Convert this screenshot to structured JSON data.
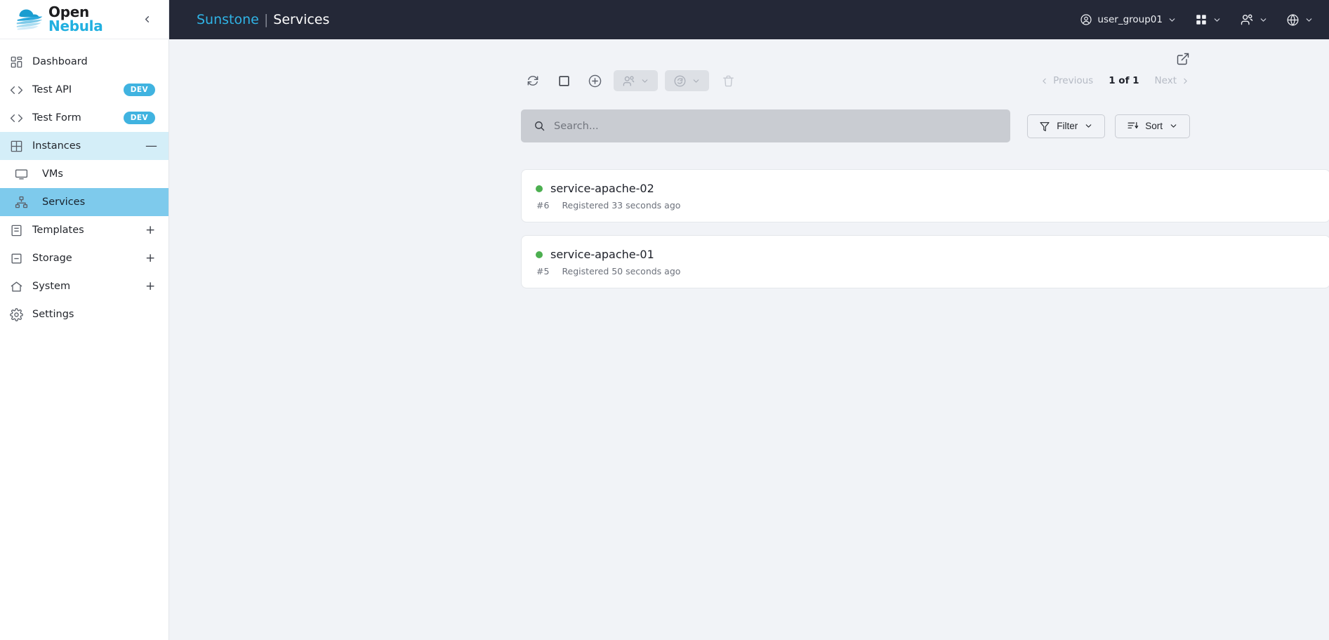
{
  "sidebar": {
    "logo": {
      "line1": "Open",
      "line2": "Nebula"
    },
    "collapse_label": "Collapse sidebar",
    "items": [
      {
        "label": "Dashboard",
        "icon": "dashboard-icon",
        "badge": "",
        "expander": ""
      },
      {
        "label": "Test API",
        "icon": "code-icon",
        "badge": "DEV",
        "expander": ""
      },
      {
        "label": "Test Form",
        "icon": "code-icon",
        "badge": "DEV",
        "expander": ""
      },
      {
        "label": "Instances",
        "icon": "grid-icon",
        "badge": "",
        "expander": "—"
      },
      {
        "label": "VMs",
        "icon": "monitor-icon",
        "badge": "",
        "expander": ""
      },
      {
        "label": "Services",
        "icon": "sitemap-icon",
        "badge": "",
        "expander": ""
      },
      {
        "label": "Templates",
        "icon": "templates-icon",
        "badge": "",
        "expander": "+"
      },
      {
        "label": "Storage",
        "icon": "storage-icon",
        "badge": "",
        "expander": "+"
      },
      {
        "label": "System",
        "icon": "home-icon",
        "badge": "",
        "expander": "+"
      },
      {
        "label": "Settings",
        "icon": "gear-icon",
        "badge": "",
        "expander": ""
      }
    ]
  },
  "header": {
    "brand": "Sunstone",
    "separator": "|",
    "section": "Services",
    "user_group": "user_group01"
  },
  "toolbar": {
    "refresh_label": "Refresh",
    "select_all_label": "Select all",
    "create_label": "Create",
    "ownership_label": "Change ownership",
    "state_label": "Change state",
    "delete_label": "Delete"
  },
  "pagination": {
    "previous": "Previous",
    "count": "1 of 1",
    "next": "Next"
  },
  "search": {
    "placeholder": "Search...",
    "value": ""
  },
  "controls": {
    "filter": "Filter",
    "sort": "Sort"
  },
  "services": [
    {
      "name": "service-apache-02",
      "id": "#6",
      "registered": "Registered 33 seconds ago",
      "state_color": "#4caf50"
    },
    {
      "name": "service-apache-01",
      "id": "#5",
      "registered": "Registered 50 seconds ago",
      "state_color": "#4caf50"
    }
  ],
  "colors": {
    "topbar": "#242837",
    "brand_accent": "#30b4e6",
    "active_nav": "#7ecaec",
    "active_parent_nav": "#d4eef8",
    "badge": "#40b3e0",
    "page_bg": "#f1f3f7",
    "status_green": "#4caf50"
  }
}
